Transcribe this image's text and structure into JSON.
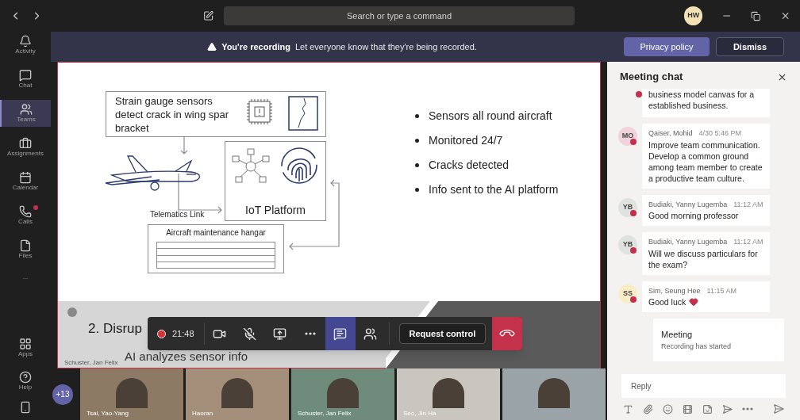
{
  "titlebar": {
    "search": {
      "placeholder": "Search or type a command"
    },
    "avatar": "HW"
  },
  "rail": [
    {
      "label": "Activity",
      "selected": false,
      "alert": false
    },
    {
      "label": "Chat",
      "selected": false,
      "alert": false
    },
    {
      "label": "Teams",
      "selected": true,
      "alert": false
    },
    {
      "label": "Assignments",
      "selected": false,
      "alert": false
    },
    {
      "label": "Calendar",
      "selected": false,
      "alert": false
    },
    {
      "label": "Calls",
      "selected": false,
      "alert": true
    },
    {
      "label": "Files",
      "selected": false,
      "alert": false
    },
    {
      "label": "...",
      "selected": false,
      "alert": false
    }
  ],
  "rail_bottom": [
    {
      "label": "Apps"
    },
    {
      "label": "Help"
    }
  ],
  "banner": {
    "title": "You're recording",
    "text": "Let everyone know that they're being recorded.",
    "buttons": [
      {
        "label": "Privacy policy",
        "primary": true
      },
      {
        "label": "Dismiss",
        "primary": false
      }
    ]
  },
  "slide": {
    "diagram": {
      "sensor_box": "Strain gauge sensors detect crack in wing spar bracket",
      "link": "Telematics Link",
      "platform": "IoT Platform",
      "hangar": "Aircraft maintenance hangar"
    },
    "bullets": [
      "Sensors all round aircraft",
      "Monitored 24/7",
      "Cracks detected",
      "Info sent to the AI platform"
    ],
    "title": "2. Disrup",
    "subtitle": "AI analyzes sensor info",
    "presenter": "Schuster, Jan Felix"
  },
  "toolbar": {
    "timer": "21:48",
    "chat_selected": true,
    "request": "Request control"
  },
  "participants": {
    "more": "+13",
    "tiles": [
      {
        "name": "Tsai, Yao-Yang"
      },
      {
        "name": "Haoran"
      },
      {
        "name": "Schuster, Jan Felix"
      },
      {
        "name": "Seo, Jin Ha"
      }
    ]
  },
  "chat": {
    "title": "Meeting chat",
    "messages": [
      {
        "kind": "partial",
        "text": "business model canvas for a established business."
      },
      {
        "kind": "message",
        "initials": "MO",
        "color": "#f1d3dc",
        "author": "Qaiser, Mohid",
        "time": "4/30 5:46 PM",
        "text": "Improve team communication. Develop a common ground among team member to create a productive team culture."
      },
      {
        "kind": "message",
        "initials": "YB",
        "color": "#dfe3df",
        "author": "Budiaki, Yanny Lugemba",
        "time": "11:12 AM",
        "text": "Good morning professor"
      },
      {
        "kind": "message",
        "initials": "YB",
        "color": "#dfe3df",
        "author": "Budiaki, Yanny Lugemba",
        "time": "11:12 AM",
        "text": "Will we discuss particulars for the exam?"
      },
      {
        "kind": "message",
        "initials": "SS",
        "color": "#f9edc8",
        "author": "Sim, Seung Hee",
        "time": "11:15 AM",
        "text": "Good luck",
        "heart": true
      },
      {
        "kind": "event",
        "title": "Meeting",
        "text": "Recording has started"
      }
    ],
    "reply": {
      "placeholder": "Reply"
    }
  }
}
